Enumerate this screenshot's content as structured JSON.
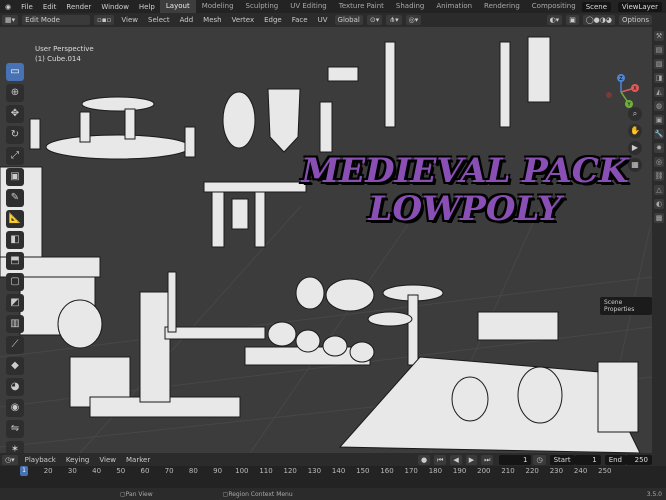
{
  "topbar": {
    "menu": [
      "File",
      "Edit",
      "Render",
      "Window",
      "Help"
    ],
    "workspaces": [
      "Layout",
      "Modeling",
      "Sculpting",
      "UV Editing",
      "Texture Paint",
      "Shading",
      "Animation",
      "Rendering",
      "Compositing"
    ],
    "scene_label": "Scene",
    "viewlayer_label": "ViewLayer"
  },
  "header": {
    "mode": "Edit Mode",
    "menus": [
      "View",
      "Select",
      "Add",
      "Mesh",
      "Vertex",
      "Edge",
      "Face",
      "UV"
    ],
    "transform": "Global",
    "options": "Options"
  },
  "viewport": {
    "perspective": "User Perspective",
    "object": "(1) Cube.014",
    "title_line1": "MEDIEVAL PACK",
    "title_line2": "LOWPOLY",
    "tooltip": "Scene Properties"
  },
  "gizmo": {
    "x": "X",
    "y": "Y",
    "z": "Z"
  },
  "timeline": {
    "menus": [
      "Playback",
      "Keying",
      "View",
      "Marker"
    ],
    "current_frame": "1",
    "start_label": "Start",
    "start": "1",
    "end_label": "End",
    "end": "250",
    "ticks": [
      "1",
      "10",
      "20",
      "30",
      "40",
      "50",
      "60",
      "70",
      "80",
      "90",
      "100",
      "110",
      "120",
      "130",
      "140",
      "150",
      "160",
      "170",
      "180",
      "190",
      "200",
      "210",
      "220",
      "230",
      "240",
      "250"
    ]
  },
  "status": {
    "pan": "Pan View",
    "context": "Region Context Menu",
    "version": "3.5.0"
  },
  "colors": {
    "accent": "#4772b3",
    "title": "#8a4fb5"
  }
}
